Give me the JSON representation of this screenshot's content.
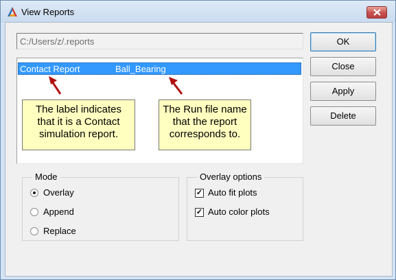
{
  "window": {
    "title": "View Reports",
    "colors": {
      "accent_selection": "#3399ff",
      "callout_bg": "#ffffc0",
      "arrow": "#b01010"
    }
  },
  "path_field": {
    "value": "C:/Users/z/.reports"
  },
  "buttons": {
    "ok": "OK",
    "close": "Close",
    "apply": "Apply",
    "delete": "Delete"
  },
  "report_list": {
    "rows": [
      {
        "label": "Contact Report",
        "run_file": "Ball_Bearing",
        "selected": true
      }
    ]
  },
  "callouts": {
    "label_note": [
      "The label indicates",
      "that it is a Contact",
      "simulation report."
    ],
    "runfile_note": [
      "The Run file name",
      "that the report",
      "corresponds to."
    ]
  },
  "mode": {
    "title": "Mode",
    "options": [
      {
        "label": "Overlay",
        "selected": true
      },
      {
        "label": "Append",
        "selected": false
      },
      {
        "label": "Replace",
        "selected": false
      }
    ]
  },
  "overlay_options": {
    "title": "Overlay options",
    "options": [
      {
        "label": "Auto fit plots",
        "checked": true
      },
      {
        "label": "Auto color plots",
        "checked": true
      }
    ]
  }
}
